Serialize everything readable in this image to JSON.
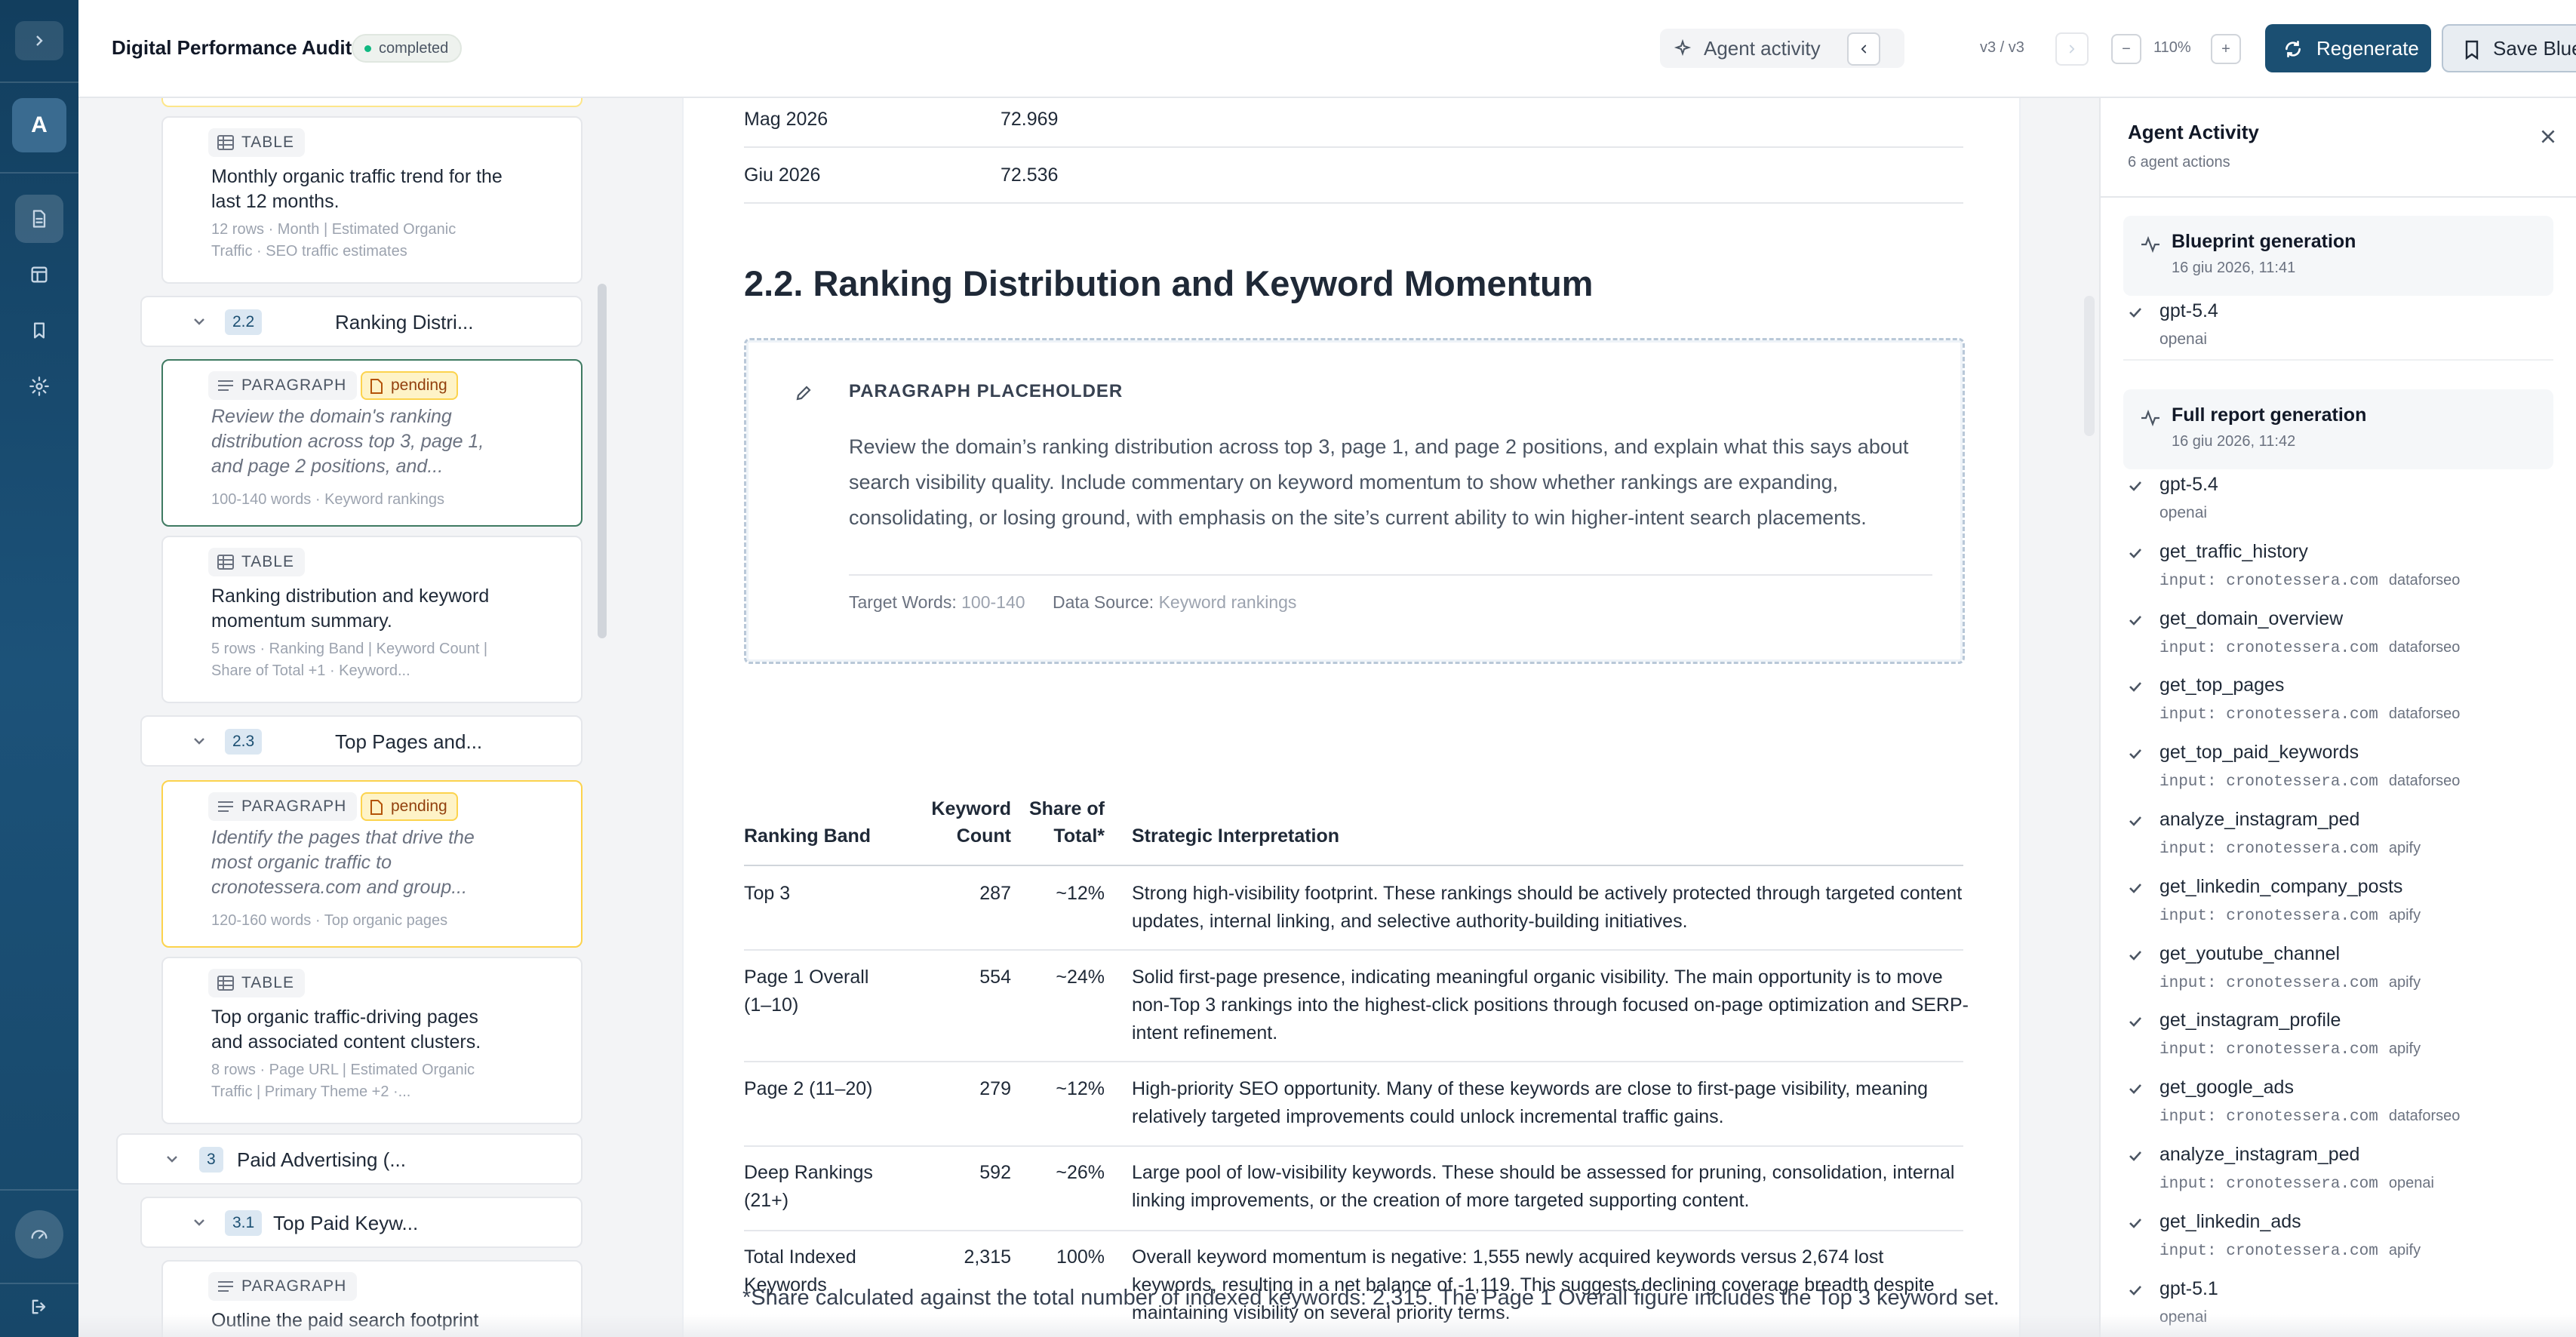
{
  "header": {
    "title": "Digital Performance Audit",
    "status": "completed",
    "agent_activity_label": "Agent activity",
    "version": "v3 / v3",
    "zoom": "110%",
    "zoom_minus": "−",
    "zoom_plus": "+",
    "regenerate_label": "Regenerate",
    "save_label": "Save Blueprint"
  },
  "rail": {
    "avatar_letter": "A",
    "icons": [
      "chevron-right-icon",
      "document-icon",
      "layout-icon",
      "bookmark-icon",
      "gear-icon",
      "gauge-icon",
      "logout-icon"
    ]
  },
  "outline": {
    "cards": [
      {
        "type": "TABLE",
        "text": "Monthly organic traffic trend for the last 12 months.",
        "meta": "12 rows · Month | Estimated Organic Traffic · SEO traffic estimates"
      },
      {
        "type": "PARAGRAPH",
        "badge": "pending",
        "text": "Review the domain's ranking distribution across top 3, page 1, and page 2 positions, and...",
        "meta": "100-140 words · Keyword rankings"
      },
      {
        "type": "TABLE",
        "text": "Ranking distribution and keyword momentum summary.",
        "meta": "5 rows · Ranking Band | Keyword Count | Share of Total +1 · Keyword..."
      },
      {
        "type": "PARAGRAPH",
        "badge": "pending",
        "text": "Identify the pages that drive the most organic traffic to cronotessera.com and group...",
        "meta": "120-160 words · Top organic pages"
      },
      {
        "type": "TABLE",
        "text": "Top organic traffic-driving pages and associated content clusters.",
        "meta": "8 rows · Page URL | Estimated Organic Traffic | Primary Theme +2 ·..."
      },
      {
        "type": "PARAGRAPH",
        "text": "Outline the paid search footprint"
      }
    ],
    "sections": [
      {
        "num": "2.2",
        "label": "Ranking Distri..."
      },
      {
        "num": "2.3",
        "label": "Top Pages and..."
      },
      {
        "num": "3",
        "label": "Paid Advertising (..."
      },
      {
        "num": "3.1",
        "label": "Top Paid Keyw..."
      }
    ]
  },
  "doc": {
    "prev_rows": [
      {
        "month": "Mag 2026",
        "value": "72.969"
      },
      {
        "month": "Giu 2026",
        "value": "72.536"
      }
    ],
    "heading": "2.2. Ranking Distribution and Keyword Momentum",
    "placeholder": {
      "label": "PARAGRAPH PLACEHOLDER",
      "text": "Review the domain’s ranking distribution across top 3, page 1, and page 2 positions, and explain what this says about search visibility quality. Include commentary on keyword momentum to show whether rankings are expanding, consolidating, or losing ground, with emphasis on the site’s current ability to win higher-intent search placements.",
      "target_words_label": "Target Words:",
      "target_words": "100-140",
      "data_source_label": "Data Source:",
      "data_source": "Keyword rankings"
    },
    "table": {
      "headers": {
        "band": "Ranking Band",
        "count": "Keyword Count",
        "share": "Share of Total*",
        "interp": "Strategic Interpretation"
      },
      "rows": [
        {
          "band": "Top 3",
          "count": "287",
          "share": "~12%",
          "interp": "Strong high-visibility footprint. These rankings should be actively protected through targeted content updates, internal linking, and selective authority-building initiatives."
        },
        {
          "band": "Page 1 Overall (1–10)",
          "count": "554",
          "share": "~24%",
          "interp": "Solid first-page presence, indicating meaningful organic visibility. The main opportunity is to move non-Top 3 rankings into the highest-click positions through focused on-page optimization and SERP-intent refinement."
        },
        {
          "band": "Page 2 (11–20)",
          "count": "279",
          "share": "~12%",
          "interp": "High-priority SEO opportunity. Many of these keywords are close to first-page visibility, meaning relatively targeted improvements could unlock incremental traffic gains."
        },
        {
          "band": "Deep Rankings (21+)",
          "count": "592",
          "share": "~26%",
          "interp": "Large pool of low-visibility keywords. These should be assessed for pruning, consolidation, internal linking improvements, or the creation of more targeted supporting content."
        },
        {
          "band": "Total Indexed Keywords",
          "count": "2,315",
          "share": "100%",
          "interp": "Overall keyword momentum is negative: 1,555 newly acquired keywords versus 2,674 lost keywords, resulting in a net balance of -1,119. This suggests declining coverage breadth despite maintaining visibility on several priority terms."
        }
      ]
    },
    "footnote": "*Share calculated against the total number of indexed keywords: 2,315. The Page 1 Overall figure includes the Top 3 keyword set."
  },
  "panel": {
    "title": "Agent Activity",
    "subtitle": "6 agent actions",
    "groups": [
      {
        "title": "Blueprint generation",
        "date": "16 giu 2026, 11:41"
      },
      {
        "title": "Full report generation",
        "date": "16 giu 2026, 11:42"
      }
    ],
    "actions": [
      {
        "name": "gpt-5.4",
        "provider": "openai"
      },
      {
        "name": "gpt-5.4",
        "provider": "openai"
      },
      {
        "name": "get_traffic_history",
        "input": "input: cronotessera.com",
        "provider": "dataforseo"
      },
      {
        "name": "get_domain_overview",
        "input": "input: cronotessera.com",
        "provider": "dataforseo"
      },
      {
        "name": "get_top_pages",
        "input": "input: cronotessera.com",
        "provider": "dataforseo"
      },
      {
        "name": "get_top_paid_keywords",
        "input": "input: cronotessera.com",
        "provider": "dataforseo"
      },
      {
        "name": "analyze_instagram_ped",
        "input": "input: cronotessera.com",
        "provider": "apify"
      },
      {
        "name": "get_linkedin_company_posts",
        "input": "input: cronotessera.com",
        "provider": "apify"
      },
      {
        "name": "get_youtube_channel",
        "input": "input: cronotessera.com",
        "provider": "apify"
      },
      {
        "name": "get_instagram_profile",
        "input": "input: cronotessera.com",
        "provider": "apify"
      },
      {
        "name": "get_google_ads",
        "input": "input: cronotessera.com",
        "provider": "dataforseo"
      },
      {
        "name": "analyze_instagram_ped",
        "input": "input: cronotessera.com",
        "provider": "openai"
      },
      {
        "name": "get_linkedin_ads",
        "input": "input: cronotessera.com",
        "provider": "apify"
      },
      {
        "name": "gpt-5.1",
        "provider": "openai"
      }
    ]
  }
}
